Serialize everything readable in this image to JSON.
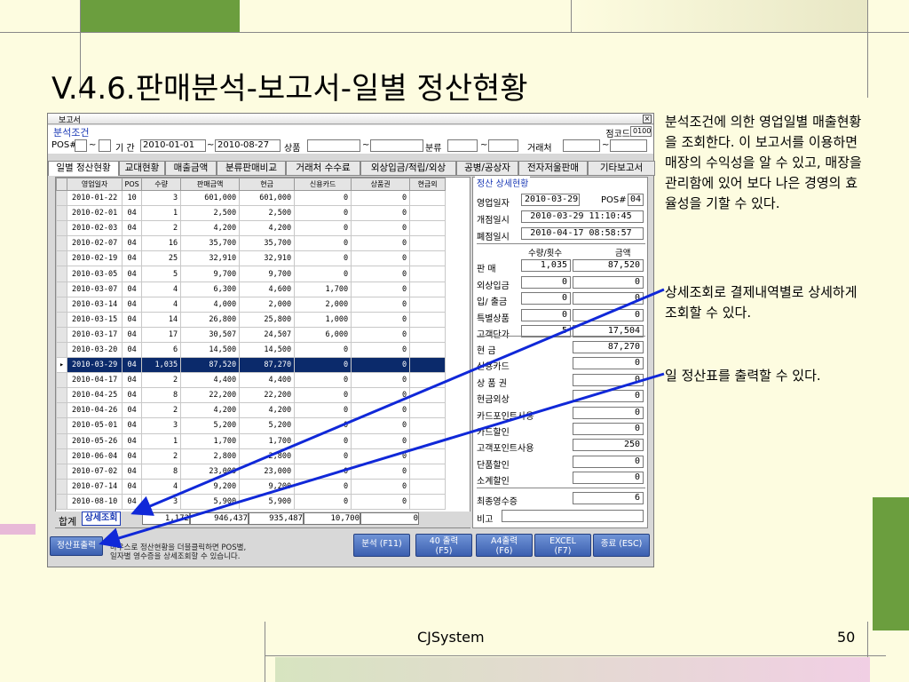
{
  "slide": {
    "title": "V.4.6.판매분석-보고서-일별 정산현황",
    "footer_name": "CJSystem",
    "page_number": "50",
    "notes": [
      "분석조건에 의한 영업일별 매출현황을 조회한다. 이 보고서를 이용하면 매장의 수익성을 알 수 있고, 매장을 관리함에 있어 보다 나은 경영의 효율성을 기할 수 있다.",
      "상세조회로 결제내역별로 상세하게 조회할 수 있다.",
      "일 정산표를 출력할 수 있다."
    ]
  },
  "window": {
    "title": "보고서",
    "close_glyph": "×",
    "filter_title": "분석조건",
    "store_code_label": "점코드",
    "store_code": "0100",
    "pos_label": "POS#",
    "period_label": "기 간",
    "date_from": "2010-01-01",
    "date_to": "2010-08-27",
    "product_label": "상품",
    "category_label": "분류",
    "vendor_label": "거래처",
    "tilde": "~",
    "tabs": [
      "일별 정산현황",
      "교대현황",
      "매출금액",
      "분류판매비교",
      "거래처 수수료",
      "외상입금/적립/외상",
      "공병/공상자",
      "전자저울판매",
      "기타보고서"
    ],
    "columns": [
      "영업일자",
      "POS",
      "수량",
      "판매금액",
      "현금",
      "신용카드",
      "상품권",
      "현금외"
    ],
    "rows": [
      [
        "2010-01-22",
        "10",
        "3",
        "601,000",
        "601,000",
        "0",
        "0"
      ],
      [
        "2010-02-01",
        "04",
        "1",
        "2,500",
        "2,500",
        "0",
        "0"
      ],
      [
        "2010-02-03",
        "04",
        "2",
        "4,200",
        "4,200",
        "0",
        "0"
      ],
      [
        "2010-02-07",
        "04",
        "16",
        "35,700",
        "35,700",
        "0",
        "0"
      ],
      [
        "2010-02-19",
        "04",
        "25",
        "32,910",
        "32,910",
        "0",
        "0"
      ],
      [
        "2010-03-05",
        "04",
        "5",
        "9,700",
        "9,700",
        "0",
        "0"
      ],
      [
        "2010-03-07",
        "04",
        "4",
        "6,300",
        "4,600",
        "1,700",
        "0"
      ],
      [
        "2010-03-14",
        "04",
        "4",
        "4,000",
        "2,000",
        "2,000",
        "0"
      ],
      [
        "2010-03-15",
        "04",
        "14",
        "26,800",
        "25,800",
        "1,000",
        "0"
      ],
      [
        "2010-03-17",
        "04",
        "17",
        "30,507",
        "24,507",
        "6,000",
        "0"
      ],
      [
        "2010-03-20",
        "04",
        "6",
        "14,500",
        "14,500",
        "0",
        "0"
      ],
      [
        "2010-03-29",
        "04",
        "1,035",
        "87,520",
        "87,270",
        "0",
        "0"
      ],
      [
        "2010-04-17",
        "04",
        "2",
        "4,400",
        "4,400",
        "0",
        "0"
      ],
      [
        "2010-04-25",
        "04",
        "8",
        "22,200",
        "22,200",
        "0",
        "0"
      ],
      [
        "2010-04-26",
        "04",
        "2",
        "4,200",
        "4,200",
        "0",
        "0"
      ],
      [
        "2010-05-01",
        "04",
        "3",
        "5,200",
        "5,200",
        "0",
        "0"
      ],
      [
        "2010-05-26",
        "04",
        "1",
        "1,700",
        "1,700",
        "0",
        "0"
      ],
      [
        "2010-06-04",
        "04",
        "2",
        "2,800",
        "2,800",
        "0",
        "0"
      ],
      [
        "2010-07-02",
        "04",
        "8",
        "23,000",
        "23,000",
        "0",
        "0"
      ],
      [
        "2010-07-14",
        "04",
        "4",
        "9,200",
        "9,200",
        "0",
        "0"
      ],
      [
        "2010-08-10",
        "04",
        "3",
        "5,900",
        "5,900",
        "0",
        "0"
      ]
    ],
    "selected_row_index": 11,
    "total_label": "합계",
    "detail_button": "상세조회",
    "totals": [
      "1,172",
      "946,437",
      "935,487",
      "10,700",
      "0"
    ],
    "detail": {
      "title": "정산 상세현황",
      "biz_date_label": "영업일자",
      "biz_date": "2010-03-29",
      "pos_label": "POS#",
      "pos": "04",
      "open_label": "개점일시",
      "open_time": "2010-03-29 11:10:45",
      "close_label": "폐점일시",
      "close_time": "2010-04-17 08:58:57",
      "qty_header": "수량/횟수",
      "amount_header": "금액",
      "lines": [
        {
          "label": "판      매",
          "qty": "1,035",
          "amount": "87,520"
        },
        {
          "label": "외상입금",
          "qty": "0",
          "amount": "0"
        },
        {
          "label": "입/ 출금",
          "qty": "0",
          "amount": "0"
        },
        {
          "label": "특별상품",
          "qty": "0",
          "amount": "0"
        },
        {
          "label": "고객단가",
          "qty": "5",
          "amount": "17,504"
        }
      ],
      "pay_lines": [
        {
          "label": "현      금",
          "amount": "87,270"
        },
        {
          "label": "신용카드",
          "amount": "0"
        },
        {
          "label": "상 품 권",
          "amount": "0"
        },
        {
          "label": "현금외상",
          "amount": "0"
        },
        {
          "label": "카드포인트사용",
          "amount": "0"
        },
        {
          "label": "카드할인",
          "amount": "0"
        },
        {
          "label": "고객포인트사용",
          "amount": "250"
        },
        {
          "label": "단품할인",
          "amount": "0"
        },
        {
          "label": "소계할인",
          "amount": "0"
        }
      ],
      "receipt_label": "최종영수증",
      "receipt": "6",
      "memo_label": "비고",
      "memo": ""
    },
    "print_button": "정산표출력",
    "note_line1": "마우스로 정산현황을 더블클릭하면 POS별,",
    "note_line2": "일자별 영수증을 상세조회할 수 있습니다.",
    "buttons": [
      {
        "label": "분석 (F11)",
        "sub": ""
      },
      {
        "label": "40 출력",
        "sub": "(F5)"
      },
      {
        "label": "A4출력",
        "sub": "(F6)"
      },
      {
        "label": "EXCEL",
        "sub": "(F7)"
      },
      {
        "label": "종료 (ESC)",
        "sub": ""
      }
    ]
  },
  "colors": {
    "accent_blue": "#0b2a6b",
    "arrow_blue": "#1028d8",
    "green": "#6b9e3e"
  }
}
